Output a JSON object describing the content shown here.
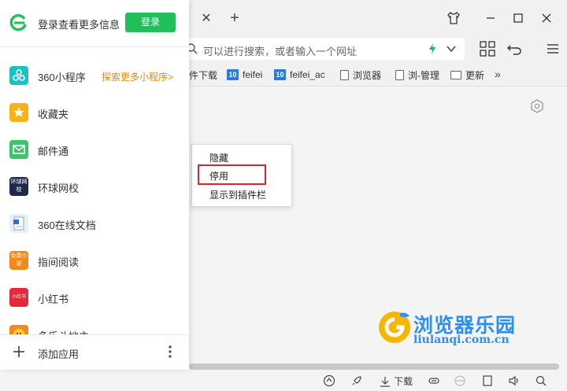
{
  "window": {
    "tab_close_glyph": "✕",
    "new_tab_glyph": "+"
  },
  "address_bar": {
    "placeholder": "可以进行搜索，或者输入一个网址"
  },
  "bookmarks": [
    {
      "label": "件下载",
      "icon": "none"
    },
    {
      "label": "feifei",
      "icon": "ten-icon"
    },
    {
      "label": "feifei_ac",
      "icon": "ten-icon"
    },
    {
      "label": "浏览器",
      "icon": "page-icon"
    },
    {
      "label": "浏-管理",
      "icon": "page-icon"
    },
    {
      "label": "更新",
      "icon": "folder-icon"
    }
  ],
  "bookmarks_more": "»",
  "ten_badge": "10",
  "context_menu": {
    "items": [
      "隐藏",
      "停用",
      "显示到插件栏"
    ],
    "highlighted": "停用",
    "highlight_color": "#d9232d"
  },
  "watermark": {
    "title": "浏览器乐园",
    "url": "liulanqi.com.cn"
  },
  "status_bar": {
    "download_label": "下载"
  },
  "side_panel": {
    "login_prompt": "登录查看更多信息",
    "login_button": "登录",
    "brand_color": "#1fc05a",
    "apps": [
      {
        "label": "360小程序",
        "icon": "mini-program-icon",
        "color": "#17c3c3",
        "extra": "探索更多小程序>"
      },
      {
        "label": "收藏夹",
        "icon": "star-icon",
        "color": "#f5b21a"
      },
      {
        "label": "邮件通",
        "icon": "mail-icon",
        "color": "#3cc46a"
      },
      {
        "label": "环球网校",
        "icon": "hqwx-icon",
        "color": "#1c2a4a",
        "icon_text": "环球网校"
      },
      {
        "label": "360在线文档",
        "icon": "doc-icon",
        "color": "#e9eef7"
      },
      {
        "label": "指间阅读",
        "icon": "novel-icon",
        "color": "#f08a1c",
        "icon_text": "免费小说"
      },
      {
        "label": "小红书",
        "icon": "xiaohongshu-icon",
        "color": "#e6283a",
        "icon_text": "小红书"
      },
      {
        "label": "多乐斗地主",
        "icon": "game-icon",
        "color": "#f08a1c"
      }
    ],
    "footer_add": "添加应用",
    "footer_more": "⋮"
  }
}
